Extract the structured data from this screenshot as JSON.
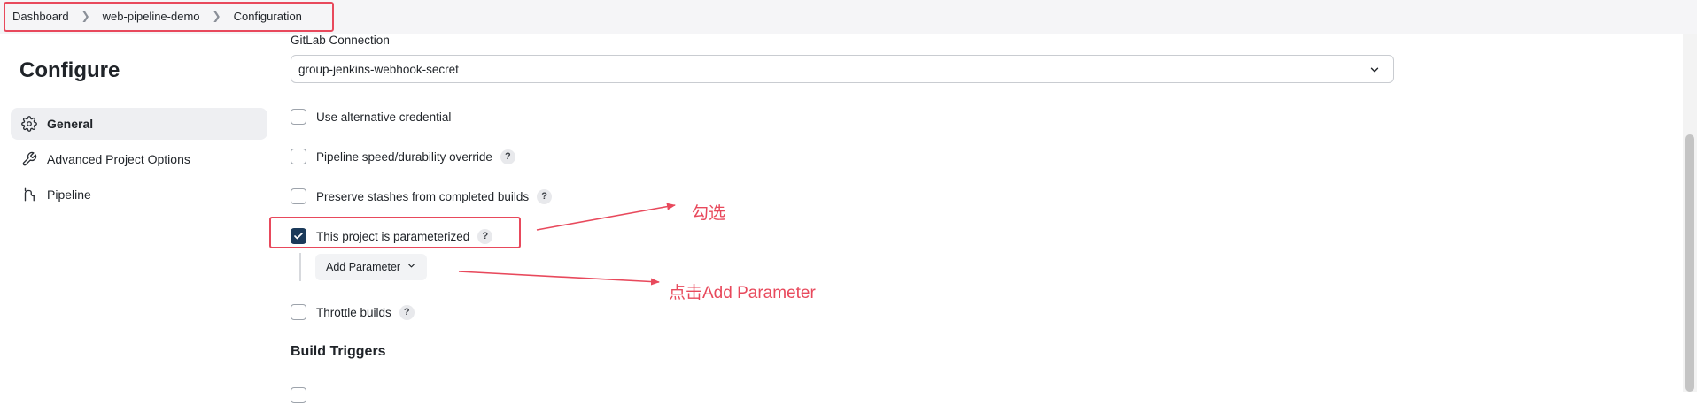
{
  "breadcrumb": [
    "Dashboard",
    "web-pipeline-demo",
    "Configuration"
  ],
  "sidebar": {
    "title": "Configure",
    "items": [
      {
        "label": "General",
        "icon": "gear-icon",
        "active": true
      },
      {
        "label": "Advanced Project Options",
        "icon": "wrench-icon",
        "active": false
      },
      {
        "label": "Pipeline",
        "icon": "pipeline-icon",
        "active": false
      }
    ]
  },
  "gitlab": {
    "label": "GitLab Connection",
    "selected": "group-jenkins-webhook-secret"
  },
  "options": [
    {
      "label": "Use alternative credential",
      "checked": false,
      "help": false
    },
    {
      "label": "Pipeline speed/durability override",
      "checked": false,
      "help": true
    },
    {
      "label": "Preserve stashes from completed builds",
      "checked": false,
      "help": true
    },
    {
      "label": "This project is parameterized",
      "checked": true,
      "help": true
    },
    {
      "label": "Throttle builds",
      "checked": false,
      "help": true
    }
  ],
  "add_parameter": "Add Parameter",
  "help_glyph": "?",
  "build_triggers": "Build Triggers",
  "annotations": {
    "check": "勾选",
    "click": "点击Add Parameter"
  },
  "colors": {
    "annotation": "#e8495c",
    "checkbox_checked": "#1b3a5a"
  }
}
